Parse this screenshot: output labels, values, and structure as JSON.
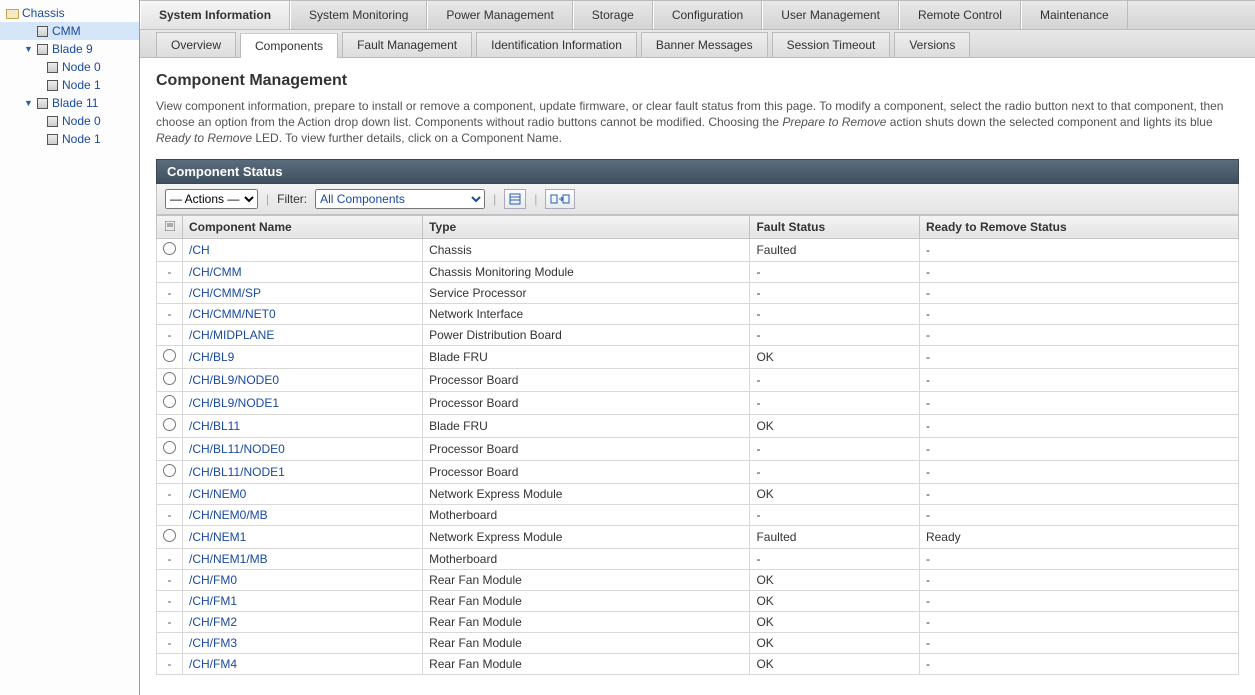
{
  "sidebar": {
    "root": "Chassis",
    "items": [
      {
        "label": "CMM",
        "selected": true
      },
      {
        "label": "Blade 9",
        "expandable": true,
        "children": [
          {
            "label": "Node 0"
          },
          {
            "label": "Node 1"
          }
        ]
      },
      {
        "label": "Blade 11",
        "expandable": true,
        "children": [
          {
            "label": "Node 0"
          },
          {
            "label": "Node 1"
          }
        ]
      }
    ]
  },
  "topTabs": [
    "System Information",
    "System Monitoring",
    "Power Management",
    "Storage",
    "Configuration",
    "User Management",
    "Remote Control",
    "Maintenance"
  ],
  "topTabActive": 0,
  "subTabs": [
    "Overview",
    "Components",
    "Fault Management",
    "Identification Information",
    "Banner Messages",
    "Session Timeout",
    "Versions"
  ],
  "subTabActive": 1,
  "page": {
    "title": "Component Management",
    "descA": "View component information, prepare to install or remove a component, update firmware, or clear fault status from this page. To modify a component, select the radio button next to that component, then choose an option from the Action drop down list. Components without radio buttons cannot be modified. Choosing the ",
    "descItalic1": "Prepare to Remove",
    "descB": " action shuts down the selected component and lights its blue ",
    "descItalic2": "Ready to Remove",
    "descC": " LED. To view further details, click on a Component Name.",
    "sectionTitle": "Component Status"
  },
  "toolbar": {
    "actionsPlaceholder": "— Actions —",
    "filterLabel": "Filter:",
    "filterValue": "All Components"
  },
  "table": {
    "columns": [
      "Component Name",
      "Type",
      "Fault Status",
      "Ready to Remove Status"
    ],
    "rows": [
      {
        "radio": true,
        "name": "/CH",
        "type": "Chassis",
        "fault": "Faulted",
        "ready": "-"
      },
      {
        "radio": false,
        "name": "/CH/CMM",
        "type": "Chassis Monitoring Module",
        "fault": "-",
        "ready": "-"
      },
      {
        "radio": false,
        "name": "/CH/CMM/SP",
        "type": "Service Processor",
        "fault": "-",
        "ready": "-"
      },
      {
        "radio": false,
        "name": "/CH/CMM/NET0",
        "type": "Network Interface",
        "fault": "-",
        "ready": "-"
      },
      {
        "radio": false,
        "name": "/CH/MIDPLANE",
        "type": "Power Distribution Board",
        "fault": "-",
        "ready": "-"
      },
      {
        "radio": true,
        "name": "/CH/BL9",
        "type": "Blade FRU",
        "fault": "OK",
        "ready": "-"
      },
      {
        "radio": true,
        "name": "/CH/BL9/NODE0",
        "type": "Processor Board",
        "fault": "-",
        "ready": "-"
      },
      {
        "radio": true,
        "name": "/CH/BL9/NODE1",
        "type": "Processor Board",
        "fault": "-",
        "ready": "-"
      },
      {
        "radio": true,
        "name": "/CH/BL11",
        "type": "Blade FRU",
        "fault": "OK",
        "ready": "-"
      },
      {
        "radio": true,
        "name": "/CH/BL11/NODE0",
        "type": "Processor Board",
        "fault": "-",
        "ready": "-"
      },
      {
        "radio": true,
        "name": "/CH/BL11/NODE1",
        "type": "Processor Board",
        "fault": "-",
        "ready": "-"
      },
      {
        "radio": false,
        "name": "/CH/NEM0",
        "type": "Network Express Module",
        "fault": "OK",
        "ready": "-"
      },
      {
        "radio": false,
        "name": "/CH/NEM0/MB",
        "type": "Motherboard",
        "fault": "-",
        "ready": "-"
      },
      {
        "radio": true,
        "name": "/CH/NEM1",
        "type": "Network Express Module",
        "fault": "Faulted",
        "ready": "Ready"
      },
      {
        "radio": false,
        "name": "/CH/NEM1/MB",
        "type": "Motherboard",
        "fault": "-",
        "ready": "-"
      },
      {
        "radio": false,
        "name": "/CH/FM0",
        "type": "Rear Fan Module",
        "fault": "OK",
        "ready": "-"
      },
      {
        "radio": false,
        "name": "/CH/FM1",
        "type": "Rear Fan Module",
        "fault": "OK",
        "ready": "-"
      },
      {
        "radio": false,
        "name": "/CH/FM2",
        "type": "Rear Fan Module",
        "fault": "OK",
        "ready": "-"
      },
      {
        "radio": false,
        "name": "/CH/FM3",
        "type": "Rear Fan Module",
        "fault": "OK",
        "ready": "-"
      },
      {
        "radio": false,
        "name": "/CH/FM4",
        "type": "Rear Fan Module",
        "fault": "OK",
        "ready": "-"
      }
    ]
  }
}
